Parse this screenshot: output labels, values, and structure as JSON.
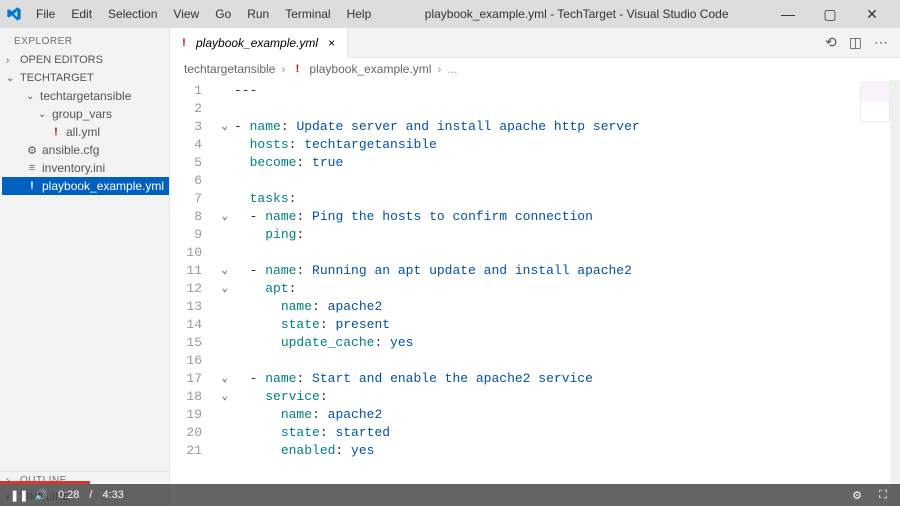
{
  "menu": {
    "items": [
      "File",
      "Edit",
      "Selection",
      "View",
      "Go",
      "Run",
      "Terminal",
      "Help"
    ]
  },
  "window": {
    "title": "playbook_example.yml - TechTarget - Visual Studio Code"
  },
  "sidebar": {
    "explorer_label": "EXPLORER",
    "open_editors": "OPEN EDITORS",
    "workspace": "TECHTARGET",
    "tree": {
      "folder1": "techtargetansible",
      "folder2": "group_vars",
      "file_all": "all.yml",
      "file_cfg": "ansible.cfg",
      "file_inv": "inventory.ini",
      "file_pb": "playbook_example.yml"
    },
    "outline": "OUTLINE",
    "timeline": "TIMELINE"
  },
  "tabs": {
    "active": "playbook_example.yml"
  },
  "breadcrumb": {
    "p1": "techtargetansible",
    "p2": "playbook_example.yml"
  },
  "code": {
    "l1": "---",
    "l3": "- name: Update server and install apache http server",
    "l4": "  hosts: techtargetansible",
    "l5": "  become: true",
    "l7": "  tasks:",
    "l8": "  - name: Ping the hosts to confirm connection",
    "l9": "    ping:",
    "l11": "  - name: Running an apt update and install apache2",
    "l12": "    apt:",
    "l13": "      name: apache2",
    "l14": "      state: present",
    "l15": "      update_cache: yes",
    "l17": "  - name: Start and enable the apache2 service",
    "l18": "    service:",
    "l19": "      name: apache2",
    "l20": "      state: started",
    "l21": "      enabled: yes"
  },
  "player": {
    "current": "0:28",
    "sep": "/",
    "total": "4:33"
  }
}
